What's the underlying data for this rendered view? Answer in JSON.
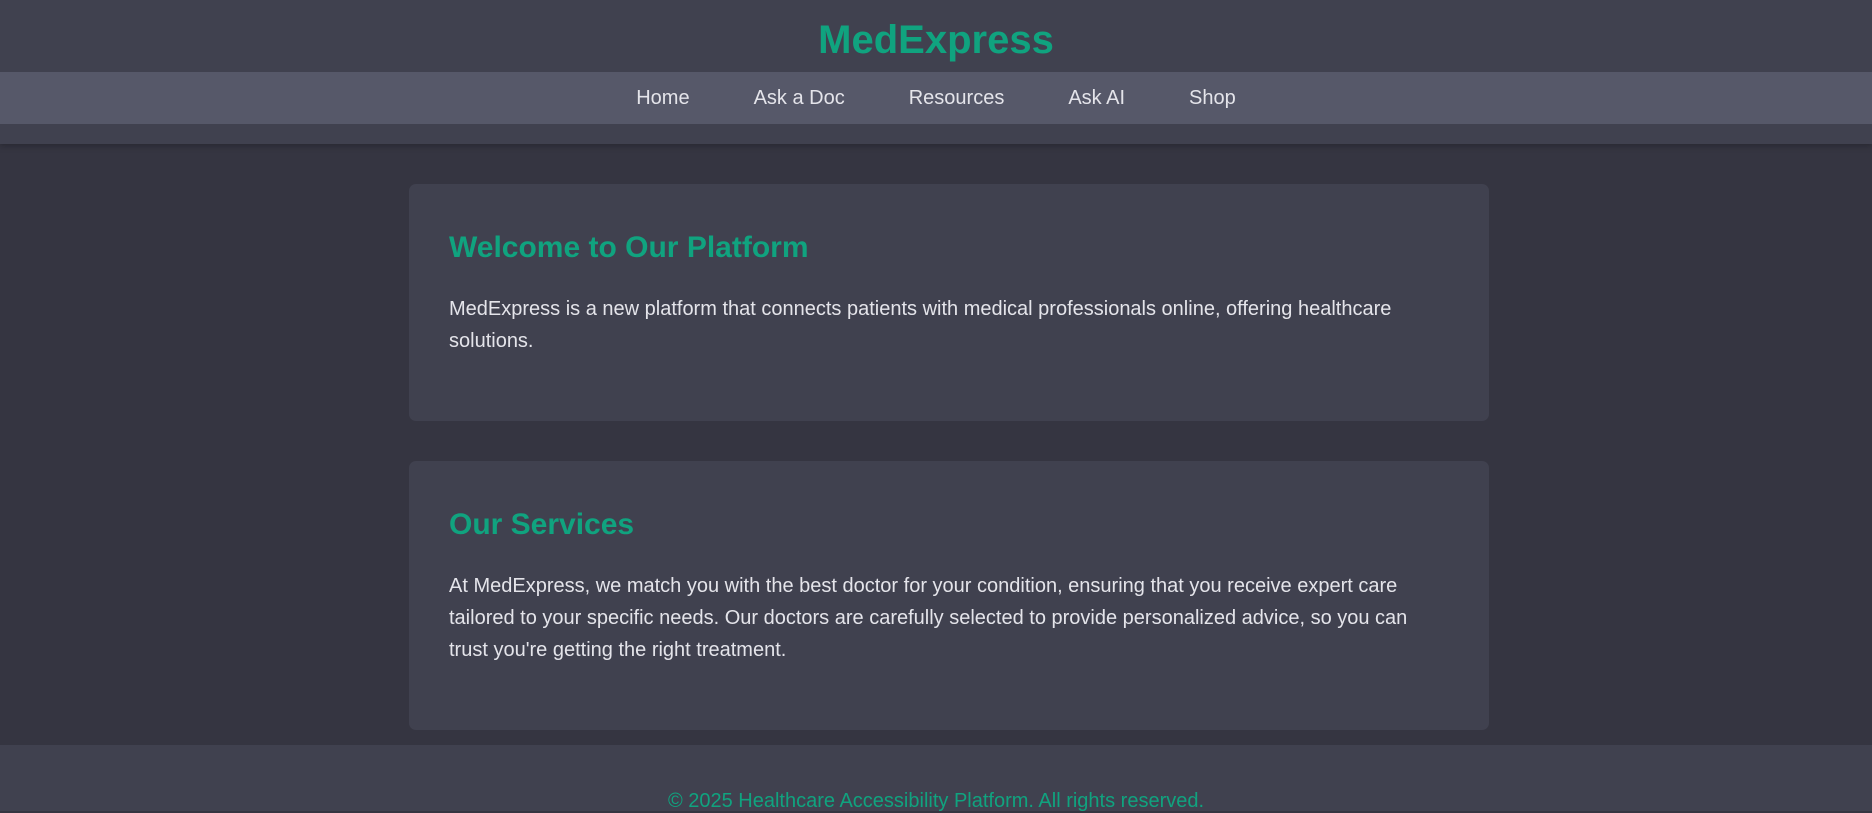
{
  "header": {
    "title": "MedExpress"
  },
  "nav": {
    "items": [
      {
        "label": "Home"
      },
      {
        "label": "Ask a Doc"
      },
      {
        "label": "Resources"
      },
      {
        "label": "Ask AI"
      },
      {
        "label": "Shop"
      }
    ]
  },
  "sections": [
    {
      "title": "Welcome to Our Platform",
      "body": "MedExpress is a new platform that connects patients with medical professionals online, offering healthcare solutions."
    },
    {
      "title": "Our Services",
      "body": "At MedExpress, we match you with the best doctor for your condition, ensuring that you receive expert care tailored to your specific needs. Our doctors are carefully selected to provide personalized advice, so you can trust you're getting the right treatment."
    }
  ],
  "footer": {
    "text": "© 2025 Healthcare Accessibility Platform. All rights reserved."
  },
  "colors": {
    "accent": "#10a37f",
    "header_bg": "#40414f",
    "nav_bg": "#565869",
    "page_bg": "#353541",
    "text": "#e4e4ea"
  }
}
